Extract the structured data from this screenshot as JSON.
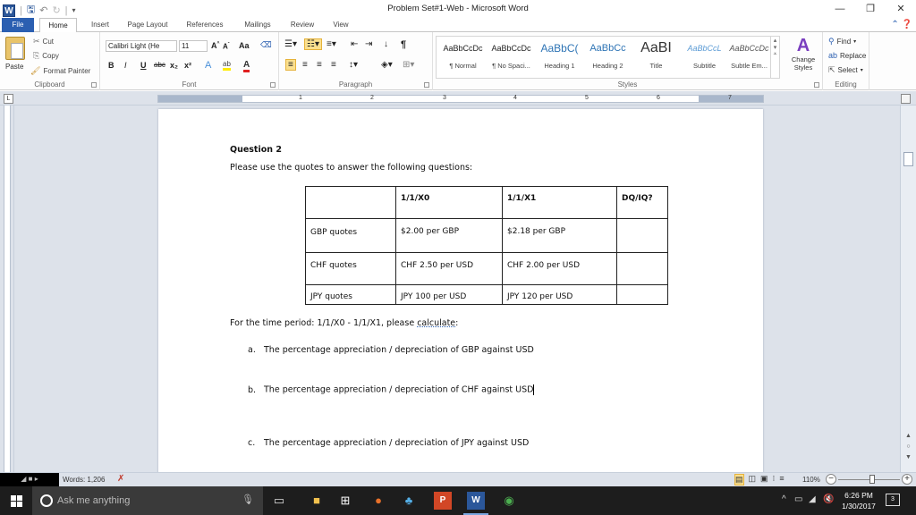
{
  "window": {
    "title": "Problem Set#1-Web  -  Microsoft Word",
    "app_icon": "word-icon",
    "qat_icons": [
      "save-icon",
      "undo-icon",
      "redo-icon",
      "customize-qat-icon"
    ],
    "controls": {
      "minimize": "—",
      "restore": "❐",
      "close": "✕"
    }
  },
  "tabs": [
    {
      "label": "File"
    },
    {
      "label": "Home"
    },
    {
      "label": "Insert"
    },
    {
      "label": "Page Layout"
    },
    {
      "label": "References"
    },
    {
      "label": "Mailings"
    },
    {
      "label": "Review"
    },
    {
      "label": "View"
    }
  ],
  "ribbon": {
    "clipboard": {
      "label": "Clipboard",
      "paste": "Paste",
      "cut": "Cut",
      "copy": "Copy",
      "format_painter": "Format Painter"
    },
    "font": {
      "label": "Font",
      "font_name": "Calibri Light (He",
      "font_size": "11",
      "change_case": "Aa",
      "bold": "B",
      "italic": "I",
      "underline": "U",
      "strike": "abc",
      "subscript": "x₂",
      "superscript": "x²"
    },
    "paragraph": {
      "label": "Paragraph",
      "pilcrow": "¶"
    },
    "styles": {
      "label": "Styles",
      "items": [
        {
          "preview": "AaBbCcDc",
          "name": "¶ Normal"
        },
        {
          "preview": "AaBbCcDc",
          "name": "¶ No Spaci..."
        },
        {
          "preview": "AaBbC(",
          "name": "Heading 1"
        },
        {
          "preview": "AaBbCc",
          "name": "Heading 2"
        },
        {
          "preview": "AaBI",
          "name": "Title"
        },
        {
          "preview": "AaBbCcL",
          "name": "Subtitle"
        },
        {
          "preview": "AaBbCcDc",
          "name": "Subtle Em..."
        }
      ],
      "change_styles": "Change Styles"
    },
    "editing": {
      "label": "Editing",
      "find": "Find",
      "replace": "Replace",
      "select": "Select"
    }
  },
  "ruler": {
    "numbers": [
      "1",
      "2",
      "3",
      "4",
      "5",
      "6",
      "7"
    ]
  },
  "document": {
    "heading": "Question 2",
    "intro": "Please use the quotes to answer the following questions:",
    "table": {
      "headers": [
        "",
        "1/1/X0",
        "1/1/X1",
        "DQ/IQ?"
      ],
      "rows": [
        [
          "GBP quotes",
          "$2.00 per GBP",
          "$2.18 per GBP",
          ""
        ],
        [
          "CHF quotes",
          "CHF 2.50 per USD",
          "CHF 2.00 per USD",
          ""
        ],
        [
          "JPY quotes",
          "JPY 100 per USD",
          "JPY 120 per USD",
          ""
        ]
      ]
    },
    "period_text_1": "For the time period: 1/1/X0 - 1/1/X1, please ",
    "period_text_2": "calculate",
    "period_text_3": ":",
    "list": [
      {
        "marker": "a.",
        "text": "The percentage appreciation / depreciation of GBP against USD"
      },
      {
        "marker": "b.",
        "text": "The percentage appreciation / depreciation of CHF against USD"
      },
      {
        "marker": "c.",
        "text": "The percentage appreciation / depreciation of JPY against USD"
      }
    ]
  },
  "statusbar": {
    "words": "Words: 1,206",
    "zoom": "110%",
    "zoom_fraction": 0.55
  },
  "taskbar": {
    "search_placeholder": "Ask me anything",
    "time": "6:26 PM",
    "date": "1/30/2017",
    "notifications": "3"
  }
}
